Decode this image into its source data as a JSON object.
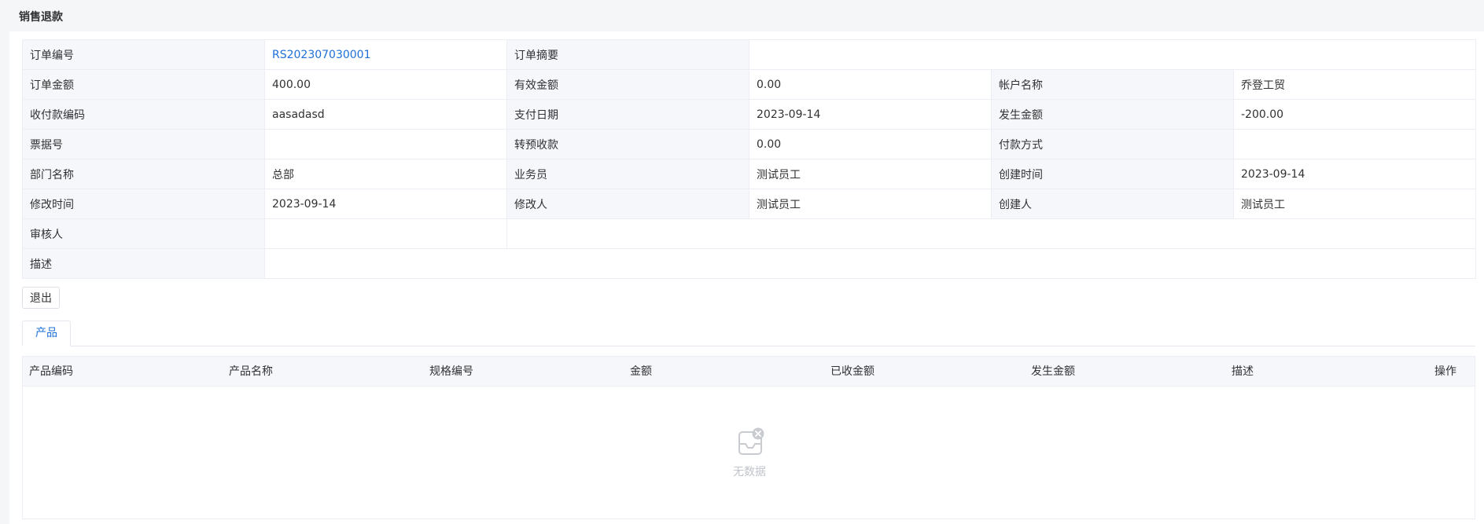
{
  "page": {
    "title": "销售退款"
  },
  "details": [
    [
      {
        "label": "订单编号",
        "value": "RS202307030001",
        "link": true
      },
      {
        "label": "订单摘要",
        "value": ""
      }
    ],
    [
      {
        "label": "订单金额",
        "value": "400.00"
      },
      {
        "label": "有效金额",
        "value": "0.00"
      },
      {
        "label": "帐户名称",
        "value": "乔登工贸"
      }
    ],
    [
      {
        "label": "收付款编码",
        "value": "aasadasd"
      },
      {
        "label": "支付日期",
        "value": "2023-09-14"
      },
      {
        "label": "发生金额",
        "value": "-200.00"
      }
    ],
    [
      {
        "label": "票据号",
        "value": ""
      },
      {
        "label": "转预收款",
        "value": "0.00"
      },
      {
        "label": "付款方式",
        "value": ""
      }
    ],
    [
      {
        "label": "部门名称",
        "value": "总部"
      },
      {
        "label": "业务员",
        "value": "测试员工"
      },
      {
        "label": "创建时间",
        "value": "2023-09-14"
      }
    ],
    [
      {
        "label": "修改时间",
        "value": "2023-09-14"
      },
      {
        "label": "修改人",
        "value": "测试员工"
      },
      {
        "label": "创建人",
        "value": "测试员工"
      }
    ],
    [
      {
        "label": "审核人",
        "value": ""
      }
    ],
    [
      {
        "label": "描述",
        "value": ""
      }
    ]
  ],
  "actions": {
    "exit_label": "退出"
  },
  "tabs": [
    {
      "label": "产品",
      "active": true
    }
  ],
  "product_table": {
    "columns": [
      "产品编码",
      "产品名称",
      "规格编号",
      "金额",
      "已收金额",
      "发生金额",
      "描述",
      "操作"
    ],
    "rows": [],
    "empty_text": "无数据",
    "empty_icon": "empty-inbox-icon"
  },
  "colors": {
    "link": "#1e6fd9",
    "label_bg": "#f5f7fa",
    "border": "#ebeef5",
    "empty_text": "#c0c4cc"
  }
}
